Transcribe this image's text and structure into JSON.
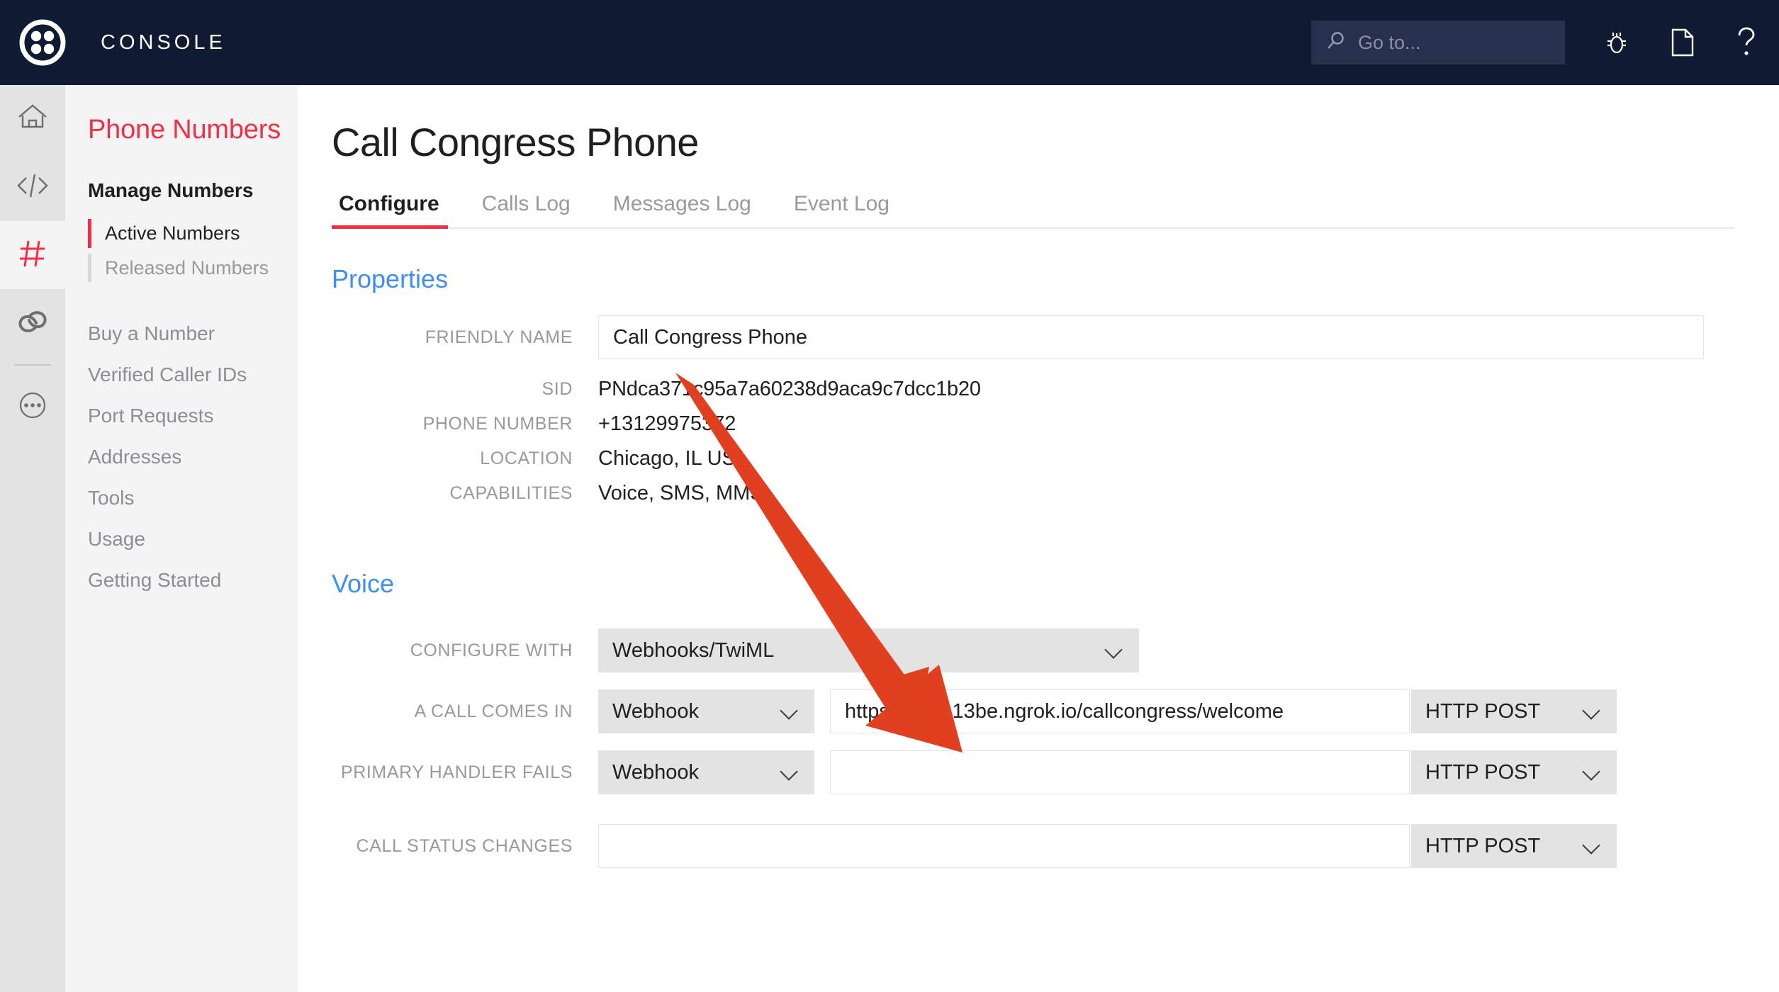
{
  "topbar": {
    "brand": "CONSOLE",
    "logo_icon": "twilio-logo-icon",
    "search": {
      "placeholder": "Go to...",
      "value": "",
      "icon": "search-icon"
    },
    "icons": [
      {
        "name": "bug-icon",
        "label": "Debugger"
      },
      {
        "name": "document-icon",
        "label": "Docs"
      },
      {
        "name": "question-mark-icon",
        "label": "Help"
      }
    ],
    "background": "#0F1A33"
  },
  "rail": {
    "items": [
      {
        "name": "home-icon",
        "active": false
      },
      {
        "name": "code-icon",
        "active": false
      },
      {
        "name": "hash-icon",
        "active": true
      },
      {
        "name": "link-icon",
        "active": false
      },
      {
        "name": "ellipsis-icon",
        "active": false
      }
    ],
    "active_color": "#F22F46"
  },
  "sidebar": {
    "title": "Phone Numbers",
    "group_label": "Manage Numbers",
    "sub_items": [
      {
        "label": "Active Numbers",
        "active": true
      },
      {
        "label": "Released Numbers",
        "active": false
      }
    ],
    "nav_items": [
      {
        "label": "Buy a Number"
      },
      {
        "label": "Verified Caller IDs"
      },
      {
        "label": "Port Requests"
      },
      {
        "label": "Addresses"
      },
      {
        "label": "Tools"
      },
      {
        "label": "Usage"
      },
      {
        "label": "Getting Started"
      }
    ],
    "title_color": "#F22F46"
  },
  "main": {
    "page_title": "Call Congress Phone",
    "tabs": [
      {
        "label": "Configure",
        "active": true
      },
      {
        "label": "Calls Log",
        "active": false
      },
      {
        "label": "Messages Log",
        "active": false
      },
      {
        "label": "Event Log",
        "active": false
      }
    ],
    "properties": {
      "heading": "Properties",
      "friendly_name": {
        "label": "FRIENDLY NAME",
        "value": "Call Congress Phone"
      },
      "sid": {
        "label": "SID",
        "value": "PNdca371c95a7a60238d9aca9c7dcc1b20"
      },
      "phone_number": {
        "label": "PHONE NUMBER",
        "value": "+13129975372"
      },
      "location": {
        "label": "LOCATION",
        "value": "Chicago, IL US"
      },
      "capabilities": {
        "label": "CAPABILITIES",
        "value": "Voice, SMS, MMS"
      }
    },
    "voice": {
      "heading": "Voice",
      "configure_with": {
        "label": "CONFIGURE WITH",
        "value": "Webhooks/TwiML"
      },
      "a_call_comes_in": {
        "label": "A CALL COMES IN",
        "handler": "Webhook",
        "url": "https://198a13be.ngrok.io/callcongress/welcome",
        "method": "HTTP POST"
      },
      "primary_handler_fails": {
        "label": "PRIMARY HANDLER FAILS",
        "handler": "Webhook",
        "url": "",
        "method": "HTTP POST"
      },
      "call_status_changes": {
        "label": "CALL STATUS CHANGES",
        "url": "",
        "method": "HTTP POST"
      }
    },
    "section_heading_color": "#3E8EF7"
  },
  "annotation": {
    "arrow_color": "#E0401F",
    "points_to": "configure-with-select"
  }
}
